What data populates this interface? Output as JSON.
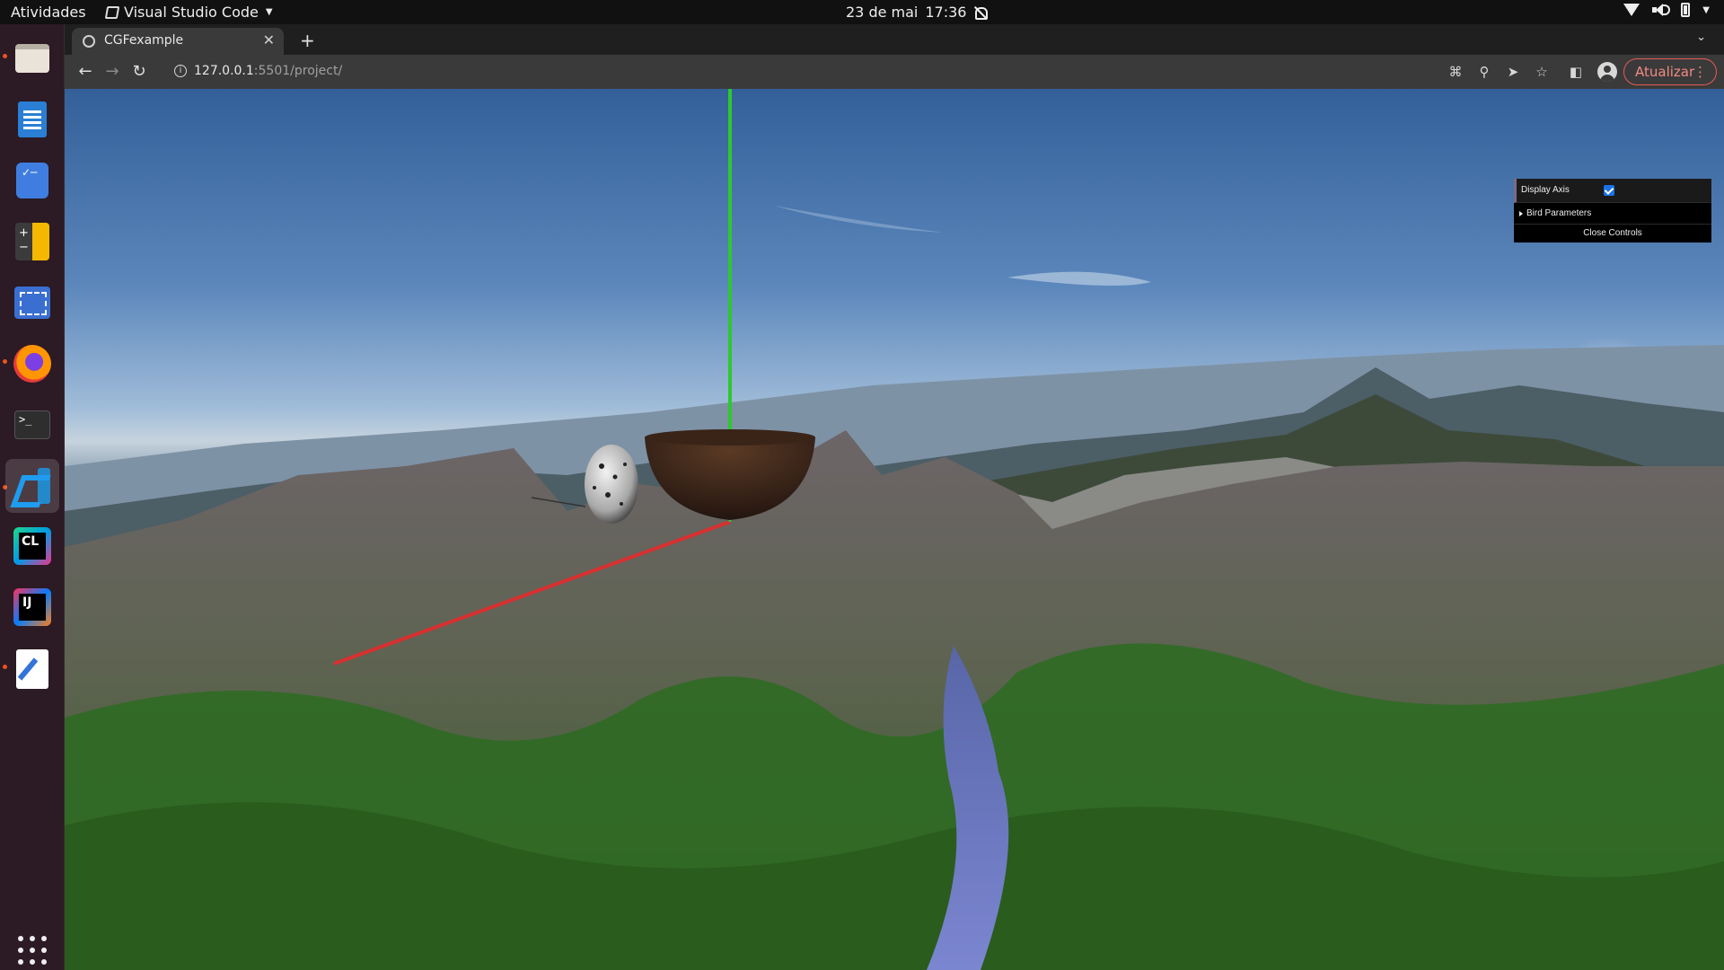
{
  "system_bar": {
    "activities": "Atividades",
    "app_name": "Visual Studio Code",
    "date": "23 de mai",
    "time": "17:36"
  },
  "dock": {
    "apps": [
      {
        "name": "Files",
        "icon": "files-icon"
      },
      {
        "name": "LibreOffice Writer",
        "icon": "writer-icon"
      },
      {
        "name": "To Do",
        "icon": "todo-icon"
      },
      {
        "name": "Calculator",
        "icon": "calculator-icon"
      },
      {
        "name": "Screenshot",
        "icon": "screenshot-icon"
      },
      {
        "name": "Firefox",
        "icon": "firefox-icon"
      },
      {
        "name": "Terminal",
        "icon": "terminal-icon"
      },
      {
        "name": "Visual Studio Code",
        "icon": "vscode-icon"
      },
      {
        "name": "CLion",
        "icon": "clion-icon"
      },
      {
        "name": "IntelliJ IDEA",
        "icon": "intellij-icon"
      },
      {
        "name": "Text Editor",
        "icon": "text-editor-icon"
      }
    ],
    "show_apps_icon": "app-grid-icon"
  },
  "browser": {
    "tab_title": "CGFexample",
    "url_host": "127.0.0.1",
    "url_rest": ":5501/project/",
    "update_label": "Atualizar"
  },
  "gui": {
    "display_axis_label": "Display Axis",
    "display_axis_checked": true,
    "bird_folder_label": "Bird Parameters",
    "close_label": "Close Controls",
    "accent_color": "#806787"
  },
  "scene": {
    "y_axis_color": "#2ec82e",
    "x_axis_color": "#d83030"
  }
}
